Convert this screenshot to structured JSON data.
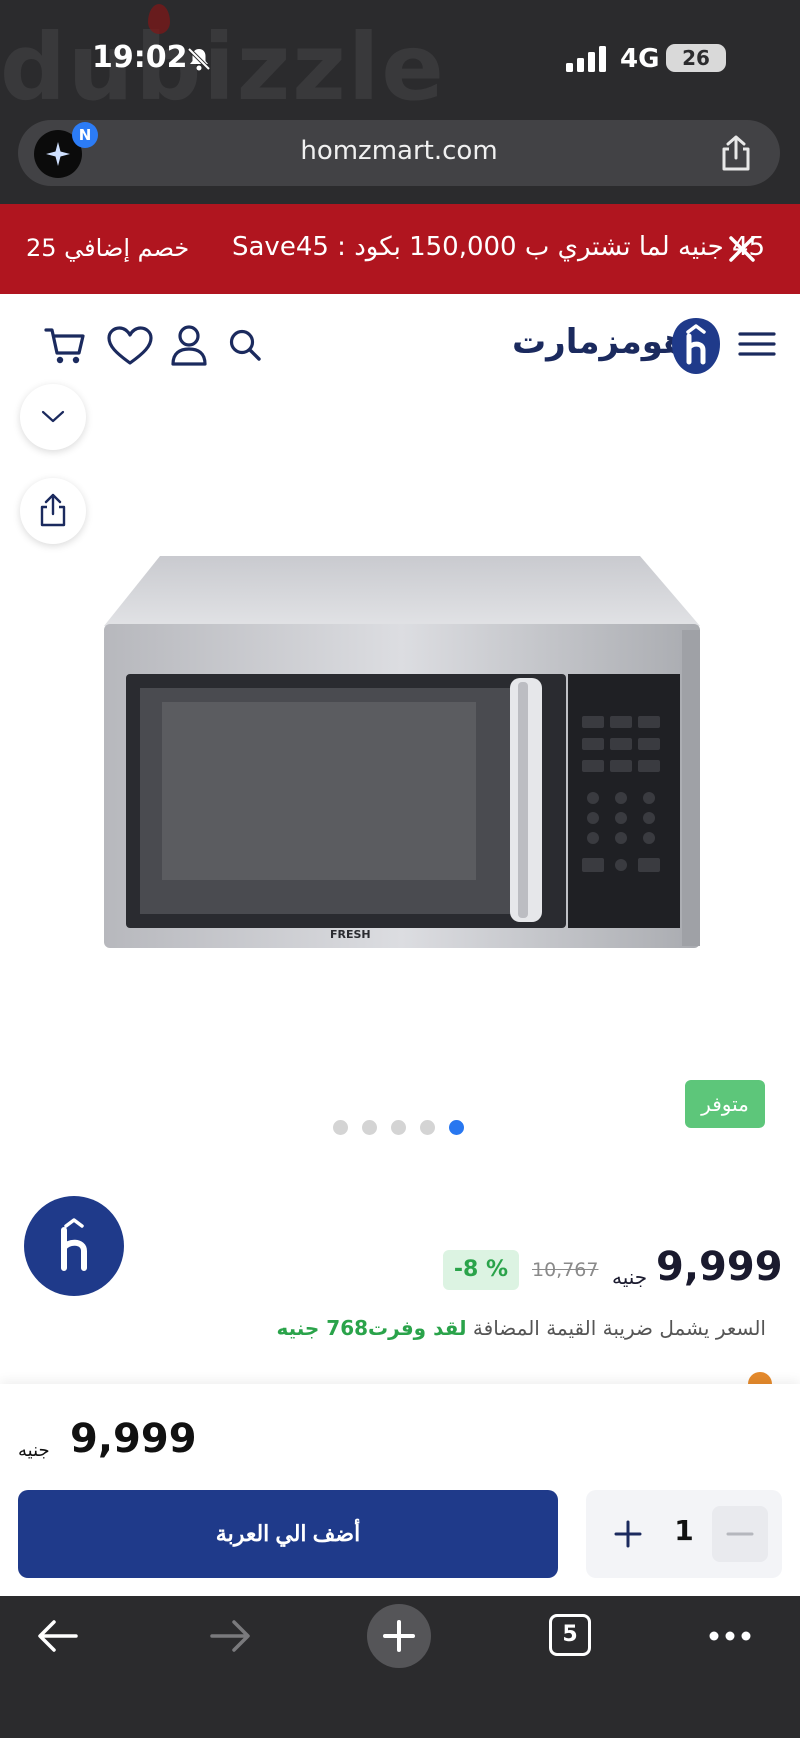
{
  "status_bar": {
    "time": "19:02",
    "network": "4G",
    "battery": "26",
    "watermark": "dubizzle"
  },
  "browser": {
    "url": "homzmart.com",
    "badge_letter": "N"
  },
  "promo": {
    "text": "45 جنيه لما تشتري ب 150,000 بكود : Save45",
    "extra": "خصم إضافي 25"
  },
  "header": {
    "logo_text": "هومزمارت"
  },
  "product": {
    "image_brand": "FRESH",
    "stock_badge": "متوفر",
    "gallery_count": 5,
    "gallery_active": 4
  },
  "pricing": {
    "price": "9,999",
    "currency": "جنيه",
    "old_price": "10,767",
    "discount": "-8 %",
    "vat_text": "السعر يشمل ضريبة القيمة المضافة",
    "savings_text": "لقد وفرت768 جنيه"
  },
  "buybar": {
    "price": "9,999",
    "currency": "جنيه",
    "add_to_cart": "أضف الي العربة",
    "quantity": "1"
  },
  "toolbar": {
    "tabs_count": "5"
  },
  "colors": {
    "promo_red": "#b0151f",
    "brand_navy": "#1f3a8a",
    "stock_green": "#5dc67a",
    "discount_green": "#2aa34a",
    "active_dot": "#2877f0"
  }
}
